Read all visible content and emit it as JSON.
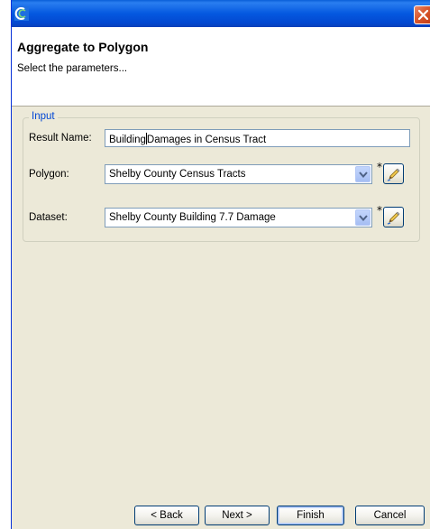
{
  "window": {
    "title": "",
    "app_icon": "app-logo-icon",
    "close_icon": "close-icon"
  },
  "header": {
    "title": "Aggregate to Polygon",
    "subtitle": "Select the parameters..."
  },
  "input_group": {
    "legend": "Input",
    "result_name": {
      "label": "Result Name:",
      "value_before_caret": "Building",
      "value_after_caret": "Damages in Census Tract"
    },
    "polygon": {
      "label": "Polygon:",
      "selected": "Shelby County Census Tracts",
      "required_mark": "*",
      "picker_icon": "pencil-icon"
    },
    "dataset": {
      "label": "Dataset:",
      "selected": "Shelby County Building 7.7 Damage",
      "required_mark": "*",
      "picker_icon": "pencil-icon"
    }
  },
  "buttons": {
    "back": "< Back",
    "next": "Next >",
    "finish": "Finish",
    "cancel": "Cancel"
  },
  "colors": {
    "title_bar": "#0458e0",
    "dialog_bg": "#ece9d8",
    "legend_text": "#0046d5",
    "close_button": "#d9582d"
  }
}
